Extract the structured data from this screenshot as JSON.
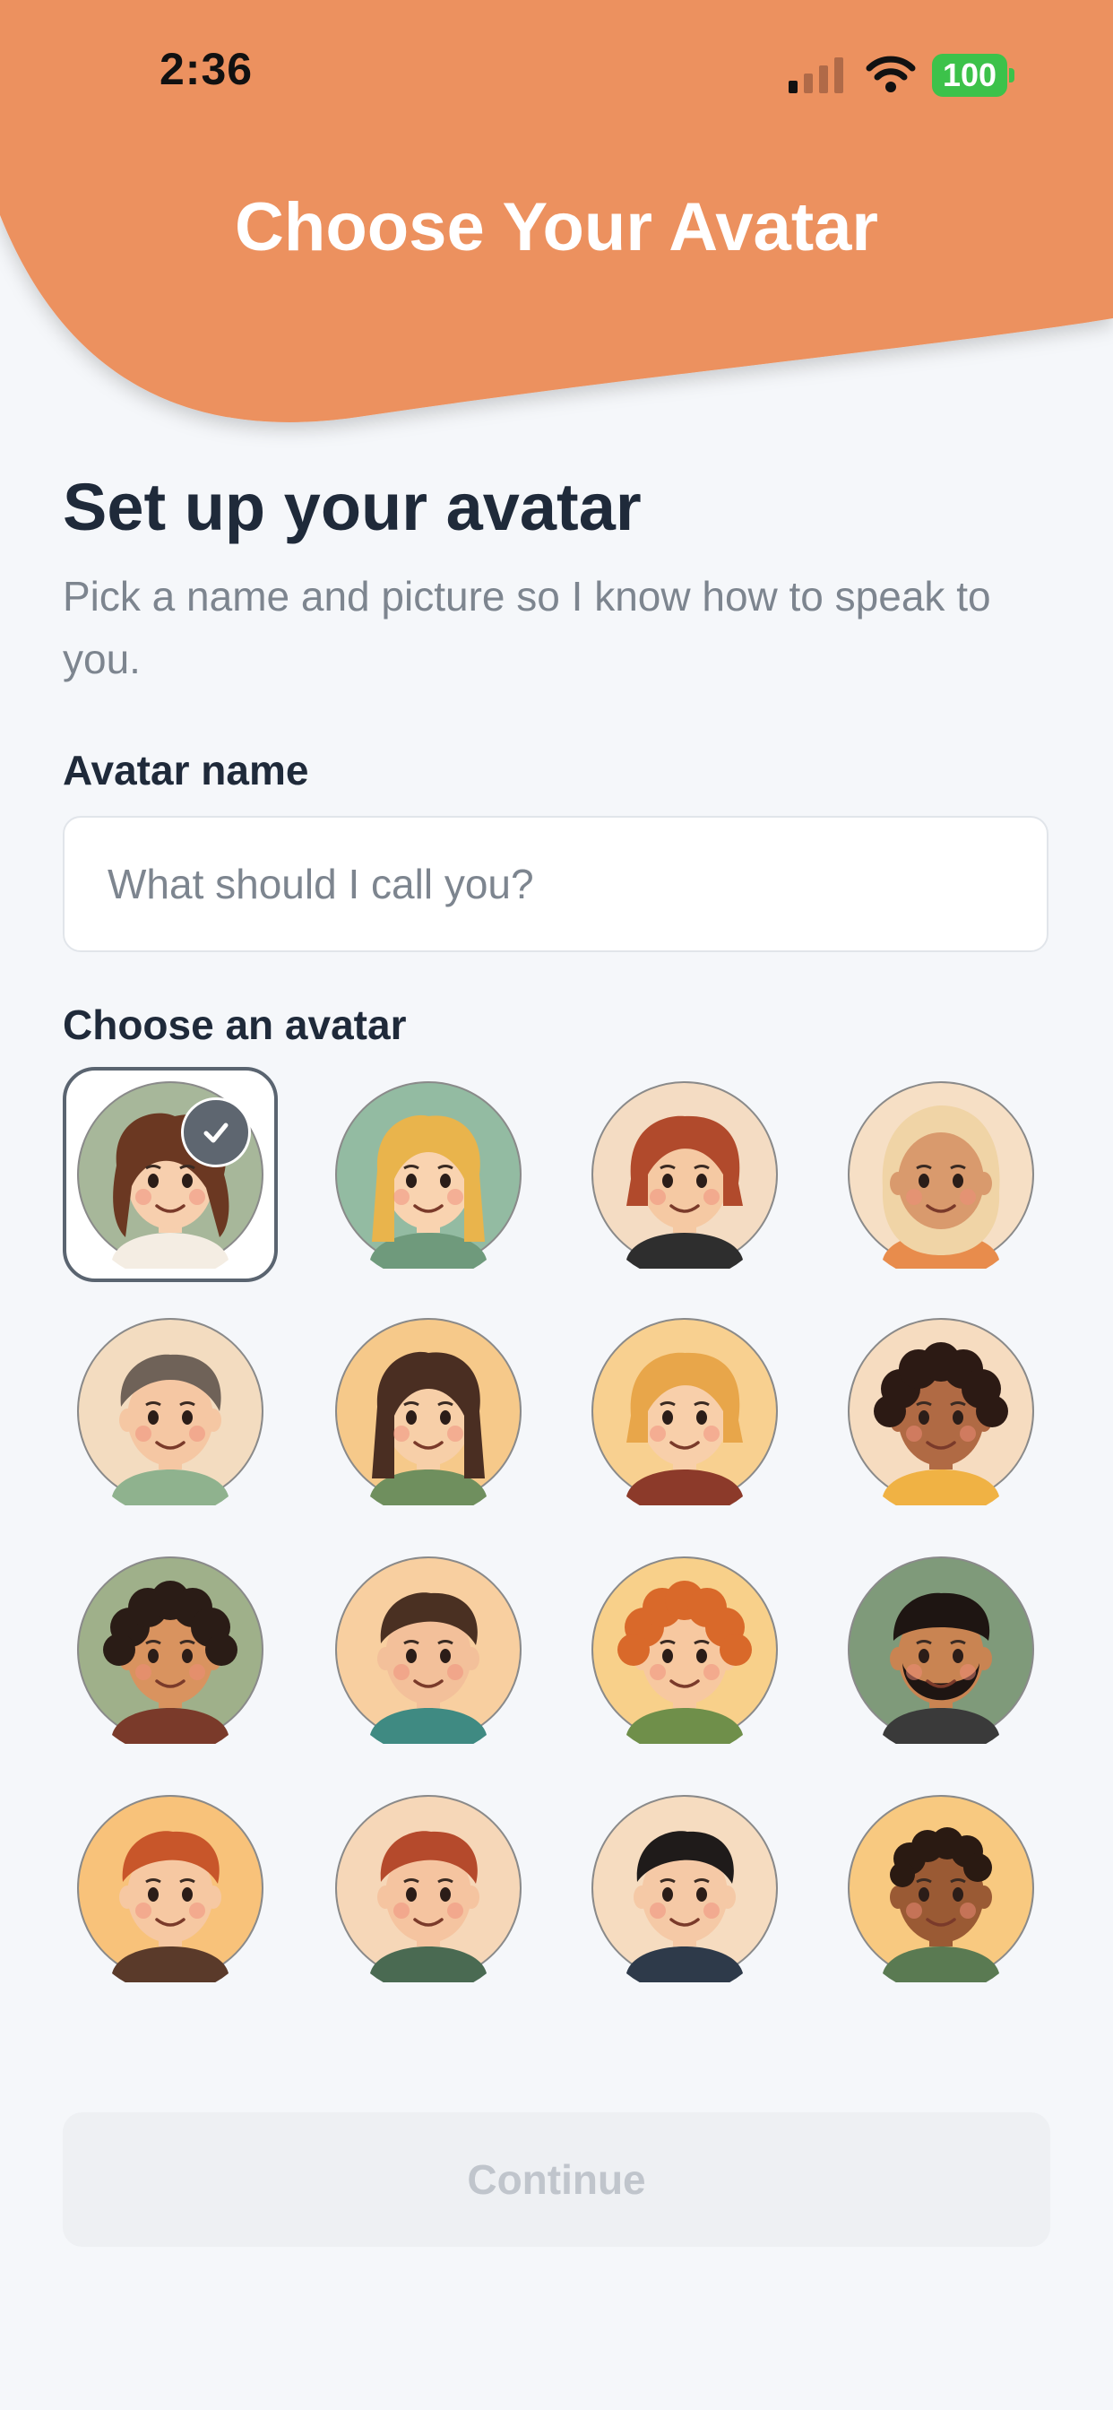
{
  "status_bar": {
    "time": "2:36",
    "battery": "100"
  },
  "header": {
    "title": "Choose Your Avatar",
    "color": "#ec915f"
  },
  "setup": {
    "title": "Set up your avatar",
    "subtitle": "Pick a name and picture so I know how to speak to you."
  },
  "name_field": {
    "label": "Avatar name",
    "placeholder": "What should I call you?",
    "value": ""
  },
  "avatar_section": {
    "label": "Choose an avatar",
    "selected_index": 0
  },
  "avatars": [
    {
      "name": "avatar-brown-wavy-hair-woman",
      "selected": true
    },
    {
      "name": "avatar-blonde-long-hair-girl",
      "selected": false
    },
    {
      "name": "avatar-red-bob-hair-woman",
      "selected": false
    },
    {
      "name": "avatar-hijab-woman",
      "selected": false
    },
    {
      "name": "avatar-gray-short-hair-woman",
      "selected": false
    },
    {
      "name": "avatar-long-brown-hair-woman",
      "selected": false
    },
    {
      "name": "avatar-blonde-bob-woman",
      "selected": false
    },
    {
      "name": "avatar-curly-dark-hair-woman",
      "selected": false
    },
    {
      "name": "avatar-curly-hair-boy",
      "selected": false
    },
    {
      "name": "avatar-middle-aged-man",
      "selected": false
    },
    {
      "name": "avatar-ginger-freckles-boy",
      "selected": false
    },
    {
      "name": "avatar-bearded-man",
      "selected": false
    },
    {
      "name": "avatar-ginger-hair-boy",
      "selected": false
    },
    {
      "name": "avatar-red-hair-man",
      "selected": false
    },
    {
      "name": "avatar-black-hair-boy",
      "selected": false
    },
    {
      "name": "avatar-short-curly-hair-boy",
      "selected": false
    }
  ],
  "continue_button": {
    "label": "Continue",
    "enabled": false
  }
}
